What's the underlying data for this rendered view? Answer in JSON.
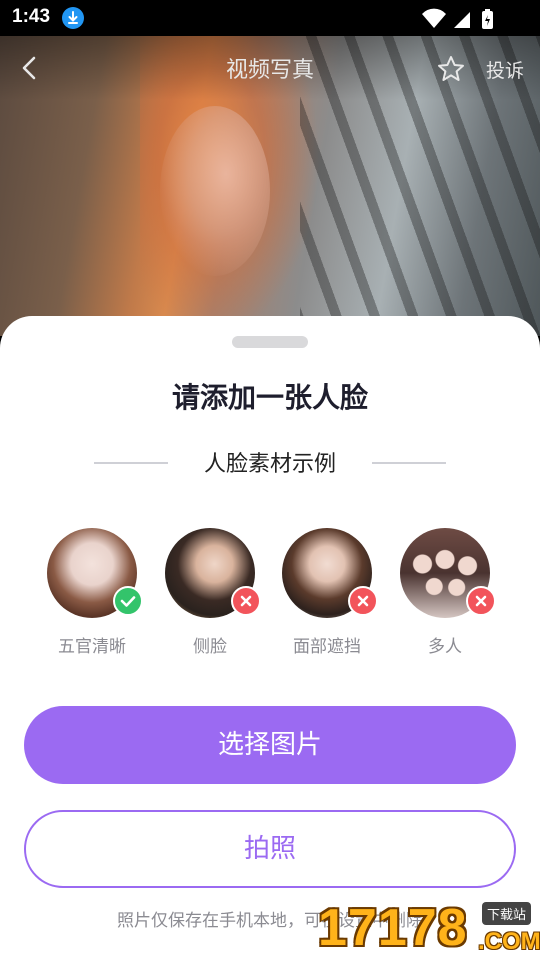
{
  "status_bar": {
    "time": "1:43",
    "icons": [
      "download-icon",
      "wifi-icon",
      "signal-icon",
      "battery-icon"
    ]
  },
  "app_bar": {
    "title": "视频写真",
    "action_label": "投诉",
    "icons": [
      "back-icon",
      "star-icon"
    ]
  },
  "sheet": {
    "title": "请添加一张人脸",
    "examples_title": "人脸素材示例",
    "examples": [
      {
        "label": "五官清晰",
        "status": "ok"
      },
      {
        "label": "侧脸",
        "status": "no"
      },
      {
        "label": "面部遮挡",
        "status": "no"
      },
      {
        "label": "多人",
        "status": "no"
      }
    ],
    "primary_button": "选择图片",
    "secondary_button": "拍照",
    "note": "照片仅保存在手机本地，可在设置中删除"
  },
  "watermark": {
    "number": "17178",
    "tag": "下载站",
    "domain": ".COM"
  },
  "colors": {
    "accent": "#9b6af2",
    "ok": "#33c46b",
    "error": "#f2545b"
  }
}
